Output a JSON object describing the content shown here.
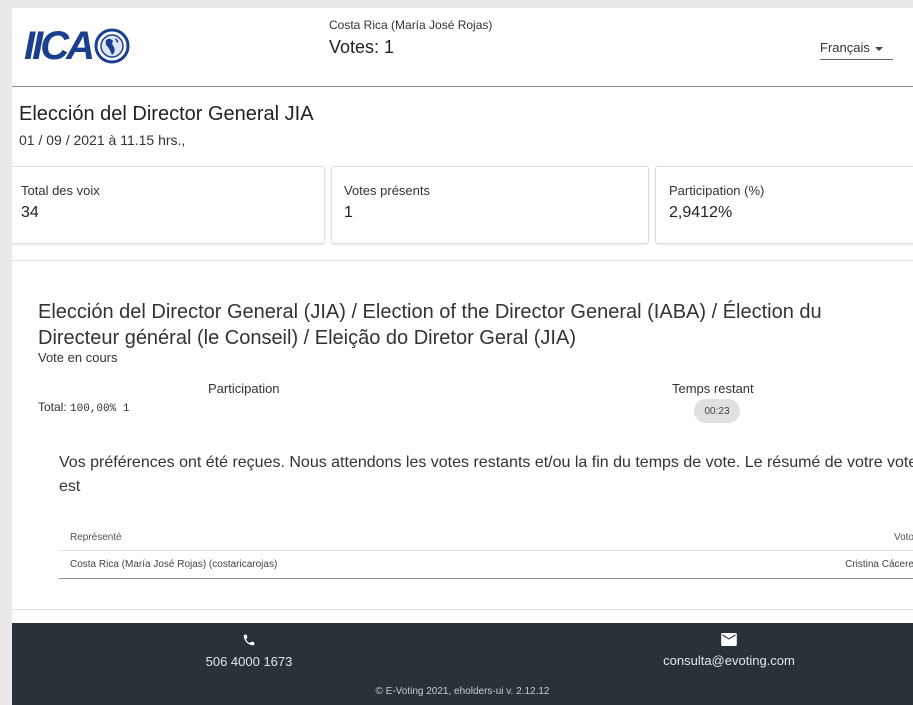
{
  "header": {
    "logo_text": "IICA",
    "voter_name": "Costa Rica (María José Rojas)",
    "votes": "Votes: 1",
    "language": "Français"
  },
  "election": {
    "title": "Elección del Director General JIA",
    "date": "01 / 09 / 2021 à 11.15 hrs.,"
  },
  "stats": [
    {
      "label": "Total des voix",
      "value": "34"
    },
    {
      "label": "Votes présents",
      "value": "1"
    },
    {
      "label": "Participation (%)",
      "value": "2,9412%"
    }
  ],
  "section": {
    "title": "Elección del Director General (JIA) / Election of the Director General (IABA) / Élection du Directeur général (le Conseil) / Eleição do Diretor Geral (JIA)",
    "status": "Vote en cours",
    "participation_label": "Participation",
    "total_label": "Total:",
    "total_value": "100,00% 1",
    "time_label": "Temps restant",
    "time_value": "00:23",
    "message": "Vos préférences ont été reçues. Nous attendons les votes restants et/ou la fin du temps de vote. Le résumé de votre vote est"
  },
  "table": {
    "headers": [
      "Représenté",
      "Votos"
    ],
    "rows": [
      [
        "Costa Rica (María José Rojas) (costaricarojas)",
        "Cristina Cáceres"
      ]
    ]
  },
  "footer": {
    "phone": "506 4000 1673",
    "email": "consulta@evoting.com",
    "copyright": "© E-Voting 2021, eholders-ui v. 2.12.12"
  },
  "colors": {
    "brand_blue": "#1b3f8f",
    "footer_bg": "#283238"
  },
  "icons": {
    "logo_emblem": "globe-emblem-icon",
    "dropdown": "caret-down-icon",
    "phone": "phone-icon",
    "email": "envelope-icon"
  }
}
